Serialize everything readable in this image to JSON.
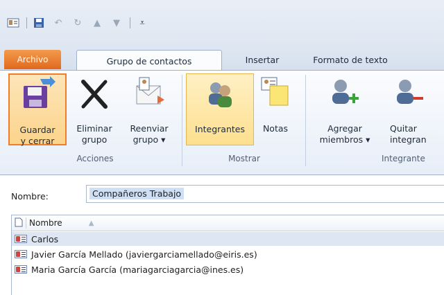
{
  "quick_access": {
    "icons": [
      "contact-card-icon",
      "save-icon",
      "undo-icon",
      "redo-icon",
      "up-arrow-icon",
      "down-arrow-icon",
      "customize-icon"
    ]
  },
  "tabs": [
    {
      "label": "Archivo"
    },
    {
      "label": "Grupo de contactos"
    },
    {
      "label": "Insertar"
    },
    {
      "label": "Formato de texto"
    }
  ],
  "ribbon": {
    "buttons": [
      {
        "label1": "Guardar",
        "label2": "y cerrar",
        "icon": "save-close-icon"
      },
      {
        "label1": "Eliminar",
        "label2": "grupo",
        "icon": "delete-x-icon"
      },
      {
        "label1": "Reenviar",
        "label2": "grupo ▾",
        "icon": "forward-group-icon"
      },
      {
        "label1": "Integrantes",
        "label2": "",
        "icon": "members-icon"
      },
      {
        "label1": "Notas",
        "label2": "",
        "icon": "notes-icon"
      },
      {
        "label1": "Agregar",
        "label2": "miembros ▾",
        "icon": "add-member-icon"
      },
      {
        "label1": "Quitar",
        "label2": "integran",
        "icon": "remove-member-icon"
      }
    ],
    "groups": [
      "Acciones",
      "Mostrar",
      "Integrante"
    ]
  },
  "name": {
    "label": "Nombre:",
    "value": "Compañeros Trabajo"
  },
  "list": {
    "column": "Nombre",
    "rows": [
      "Carlos",
      "Javier García Mellado (javiergarciamellado@eiris.es)",
      "Maria García García (mariagarciagarcia@ines.es)"
    ]
  },
  "colors": {
    "file_tab": "#e0691e",
    "highlight_orange": "#f07d2a",
    "highlight_yellow": "#fddf8e",
    "selection": "#cfe0f5"
  }
}
